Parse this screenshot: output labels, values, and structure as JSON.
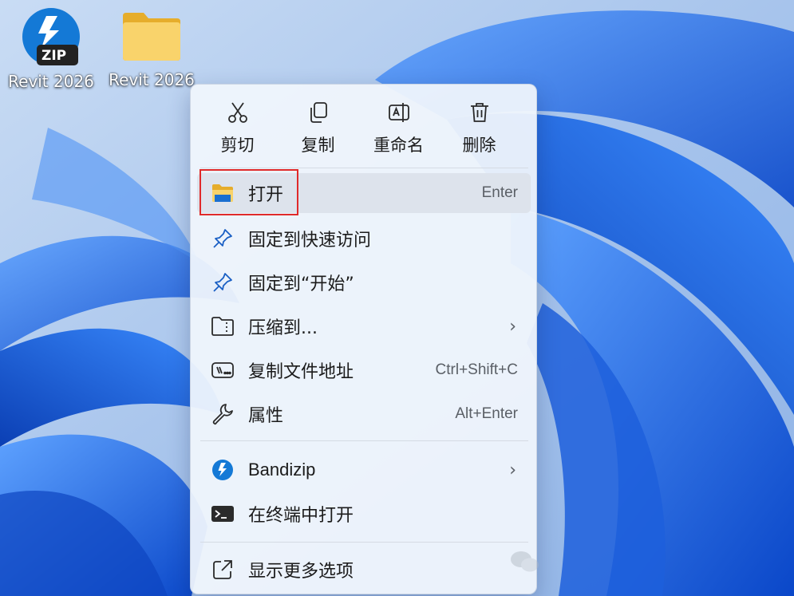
{
  "desktop": {
    "icons": [
      {
        "label": "Revit 2026",
        "badge": "ZIP",
        "icon": "bandizip-zip-icon"
      },
      {
        "label": "Revit 2026",
        "icon": "folder-icon"
      }
    ]
  },
  "context_menu": {
    "quick_actions": [
      {
        "label": "剪切",
        "icon": "scissors-icon"
      },
      {
        "label": "复制",
        "icon": "copy-icon"
      },
      {
        "label": "重命名",
        "icon": "rename-icon"
      },
      {
        "label": "删除",
        "icon": "trash-icon"
      }
    ],
    "items": [
      {
        "label": "打开",
        "shortcut": "Enter",
        "icon": "folder-icon",
        "highlighted": true
      },
      {
        "label": "固定到快速访问",
        "icon": "pin-icon"
      },
      {
        "label": "固定到“开始”",
        "icon": "pin-icon"
      },
      {
        "label": "压缩到...",
        "icon": "archive-icon",
        "submenu": "›"
      },
      {
        "label": "复制文件地址",
        "shortcut": "Ctrl+Shift+C",
        "icon": "path-icon"
      },
      {
        "label": "属性",
        "shortcut": "Alt+Enter",
        "icon": "wrench-icon"
      },
      {
        "label": "Bandizip",
        "icon": "bandizip-icon",
        "submenu": "›"
      },
      {
        "label": "在终端中打开",
        "icon": "terminal-icon"
      },
      {
        "label": "显示更多选项",
        "icon": "external-icon"
      }
    ]
  },
  "colors": {
    "accent": "#0a6fd8",
    "highlight_box": "#e02a2a",
    "folder": "#f7c948"
  }
}
